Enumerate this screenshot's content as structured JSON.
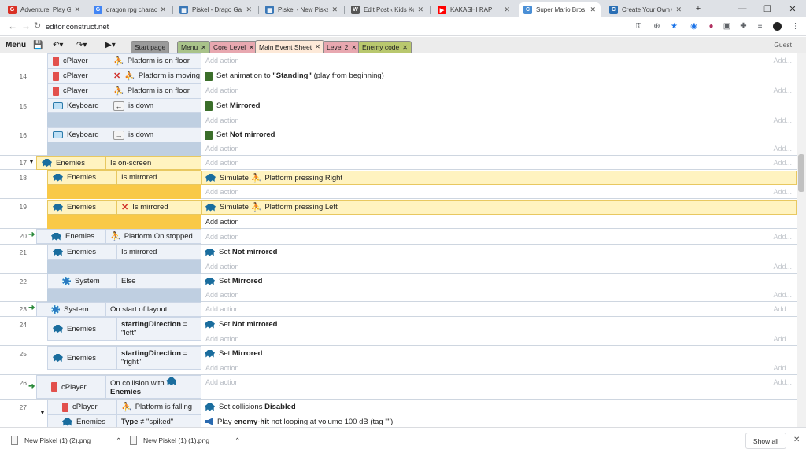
{
  "browser": {
    "tabs": [
      {
        "title": "Adventure: Play Ga",
        "icon": "game-icon",
        "color": "#d93025",
        "glyph": "G"
      },
      {
        "title": "dragon rpg charac",
        "icon": "google-icon",
        "color": "#4285f4",
        "glyph": "G"
      },
      {
        "title": "Piskel - Drago Gan",
        "icon": "piskel-icon",
        "color": "#3b78b7",
        "glyph": "▦"
      },
      {
        "title": "Piskel - New Piskel",
        "icon": "piskel-icon",
        "color": "#3b78b7",
        "glyph": "▦"
      },
      {
        "title": "Edit Post ‹ Kids Ko",
        "icon": "wordpress-icon",
        "color": "#555555",
        "glyph": "W"
      },
      {
        "title": "KAKASHI RAP",
        "icon": "youtube-icon",
        "color": "#ff0000",
        "glyph": "▶"
      },
      {
        "title": "Super Mario Bros.",
        "icon": "construct-icon",
        "color": "#4a8fd6",
        "glyph": "C"
      },
      {
        "title": "Create Your Own C",
        "icon": "construct-icon",
        "color": "#2a6fb5",
        "glyph": "C"
      }
    ],
    "new_tab": "+",
    "url": "editor.construct.net"
  },
  "editor": {
    "menu_label": "Menu",
    "tabs": [
      {
        "label": "Start page",
        "color": "#9a9a9a"
      },
      {
        "label": "Menu",
        "color": "#a9c38a"
      },
      {
        "label": "Core Level",
        "color": "#e8a8b0"
      },
      {
        "label": "Main Event Sheet",
        "color": "#fde9d8"
      },
      {
        "label": "Level 2",
        "color": "#e8a8b0"
      },
      {
        "label": "Enemy code",
        "color": "#b9c86e"
      }
    ],
    "user": "Guest",
    "add_action": "Add action",
    "add_short": "Add..."
  },
  "events": {
    "r13": {
      "c1_obj": "cPlayer",
      "c1_txt": "Platform is on floor"
    },
    "r14": {
      "num": "14",
      "c1_obj": "cPlayer",
      "c1_txt": "Platform is moving",
      "c2_obj": "cPlayer",
      "c2_txt": "Platform is on floor",
      "a1_pre": "Set animation to ",
      "a1_bold": "\"Standing\"",
      "a1_post": " (play from beginning)"
    },
    "r15": {
      "num": "15",
      "c1_obj": "Keyboard",
      "key": "←",
      "c1_txt": "is down",
      "a1_pre": "Set ",
      "a1_bold": "Mirrored"
    },
    "r16": {
      "num": "16",
      "c1_obj": "Keyboard",
      "key": "→",
      "c1_txt": "is down",
      "a1_pre": "Set ",
      "a1_bold": "Not mirrored"
    },
    "r17": {
      "num": "17",
      "c1_obj": "Enemies",
      "c1_txt": "Is on-screen"
    },
    "r18": {
      "num": "18",
      "c1_obj": "Enemies",
      "c1_txt": "Is mirrored",
      "a1_pre": "Simulate ",
      "a1_txt": "Platform pressing Right"
    },
    "r19": {
      "num": "19",
      "c1_obj": "Enemies",
      "c1_txt": "Is mirrored",
      "a1_pre": "Simulate ",
      "a1_txt": "Platform pressing Left"
    },
    "r20": {
      "num": "20",
      "c1_obj": "Enemies",
      "c1_txt": "Platform On stopped"
    },
    "r21": {
      "num": "21",
      "c1_obj": "Enemies",
      "c1_txt": "Is mirrored",
      "a1_pre": "Set ",
      "a1_bold": "Not mirrored"
    },
    "r22": {
      "num": "22",
      "c1_obj": "System",
      "c1_txt": "Else",
      "a1_pre": "Set ",
      "a1_bold": "Mirrored"
    },
    "r23": {
      "num": "23",
      "c1_obj": "System",
      "c1_txt": "On start of layout"
    },
    "r24": {
      "num": "24",
      "c1_obj": "Enemies",
      "c1_bold": "startingDirection",
      "c1_txt": " =",
      "c1_val": "\"left\"",
      "a1_pre": "Set ",
      "a1_bold": "Not mirrored"
    },
    "r25": {
      "num": "25",
      "c1_obj": "Enemies",
      "c1_bold": "startingDirection",
      "c1_txt": " =",
      "c1_val": "\"right\"",
      "a1_pre": "Set ",
      "a1_bold": "Mirrored"
    },
    "r26": {
      "num": "26",
      "c1_obj": "cPlayer",
      "c1_txt": "On collision with",
      "c1_bold": "Enemies"
    },
    "r27": {
      "num": "27",
      "c1_obj": "cPlayer",
      "c1_txt": "Platform is falling",
      "c2_obj": "Enemies",
      "c2_bold": "Type",
      "c2_txt": " ≠ \"spiked\"",
      "a1_pre": "Set collisions ",
      "a1_bold": "Disabled",
      "a2_pre": "Play ",
      "a2_bold": "enemy-hit",
      "a2_post": " not looping at volume 100 dB (tag \"\")"
    }
  },
  "downloads": {
    "items": [
      "New Piskel (1) (2).png",
      "New Piskel (1) (1).png"
    ],
    "show_all": "Show all"
  }
}
